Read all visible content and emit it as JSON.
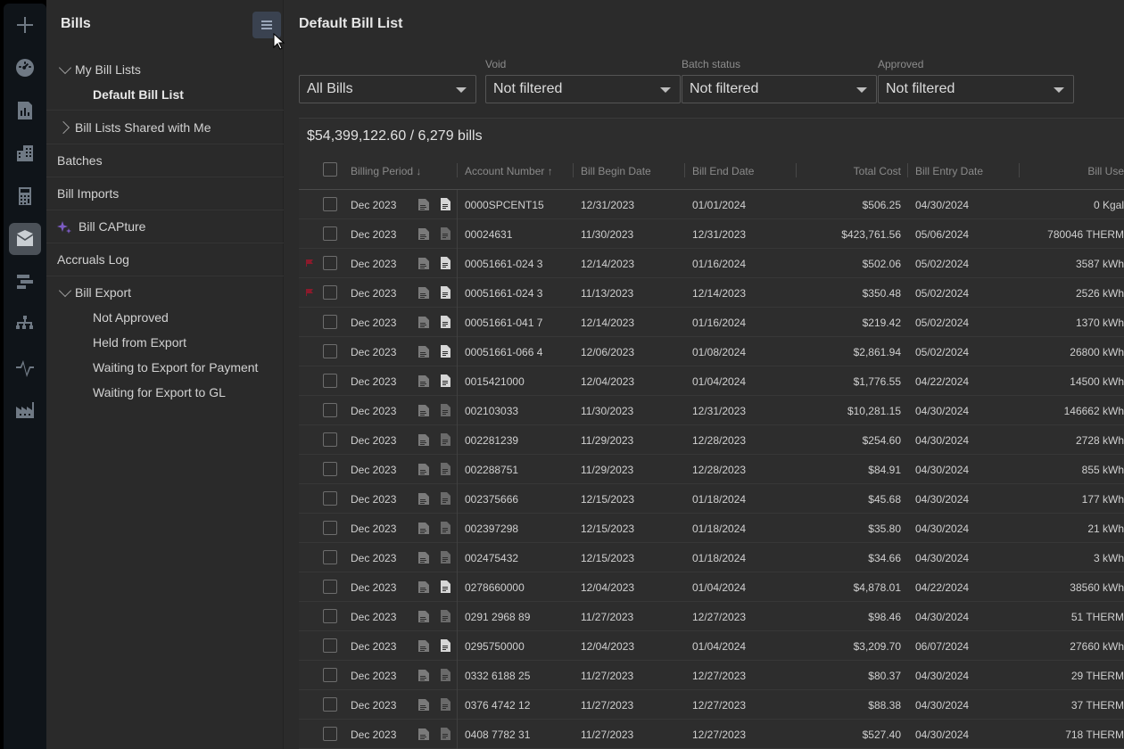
{
  "subnav": {
    "title": "Bills",
    "items": [
      {
        "label": "My Bill Lists"
      },
      {
        "label": "Default Bill List"
      },
      {
        "label": "Bill Lists Shared with Me"
      },
      {
        "label": "Batches"
      },
      {
        "label": "Bill Imports"
      },
      {
        "label": "Bill CAPture"
      },
      {
        "label": "Accruals Log"
      },
      {
        "label": "Bill Export"
      },
      {
        "label": "Not Approved"
      },
      {
        "label": "Held from Export"
      },
      {
        "label": "Waiting to Export for Payment"
      },
      {
        "label": "Waiting for Export to GL"
      }
    ]
  },
  "main": {
    "title": "Default Bill List",
    "filters": {
      "list_value": "All Bills",
      "void_label": "Void",
      "void_value": "Not filtered",
      "batch_label": "Batch status",
      "batch_value": "Not filtered",
      "approved_label": "Approved",
      "approved_value": "Not filtered"
    },
    "summary": "$54,399,122.60 / 6,279 bills",
    "columns": {
      "billing_period": "Billing Period",
      "account_number": "Account Number",
      "begin": "Bill Begin Date",
      "end": "Bill End Date",
      "total": "Total Cost",
      "entry": "Bill Entry Date",
      "use": "Bill Use"
    },
    "rows": [
      {
        "period": "Dec 2023",
        "account": "0000SPCENT15",
        "begin": "12/31/2023",
        "end": "01/01/2024",
        "total": "$506.25",
        "entry": "04/30/2024",
        "use": "0 Kgal"
      },
      {
        "period": "Dec 2023",
        "account": "00024631",
        "begin": "11/30/2023",
        "end": "12/31/2023",
        "total": "$423,761.56",
        "entry": "05/06/2024",
        "use": "780046 THERM"
      },
      {
        "period": "Dec 2023",
        "account": "00051661-024 3",
        "begin": "12/14/2023",
        "end": "01/16/2024",
        "total": "$502.06",
        "entry": "05/02/2024",
        "use": "3587 kWh"
      },
      {
        "period": "Dec 2023",
        "account": "00051661-024 3",
        "begin": "11/13/2023",
        "end": "12/14/2023",
        "total": "$350.48",
        "entry": "05/02/2024",
        "use": "2526 kWh"
      },
      {
        "period": "Dec 2023",
        "account": "00051661-041 7",
        "begin": "12/14/2023",
        "end": "01/16/2024",
        "total": "$219.42",
        "entry": "05/02/2024",
        "use": "1370 kWh"
      },
      {
        "period": "Dec 2023",
        "account": "00051661-066 4",
        "begin": "12/06/2023",
        "end": "01/08/2024",
        "total": "$2,861.94",
        "entry": "05/02/2024",
        "use": "26800 kWh"
      },
      {
        "period": "Dec 2023",
        "account": "0015421000",
        "begin": "12/04/2023",
        "end": "01/04/2024",
        "total": "$1,776.55",
        "entry": "04/22/2024",
        "use": "14500 kWh"
      },
      {
        "period": "Dec 2023",
        "account": "002103033",
        "begin": "11/30/2023",
        "end": "12/31/2023",
        "total": "$10,281.15",
        "entry": "04/30/2024",
        "use": "146662 kWh"
      },
      {
        "period": "Dec 2023",
        "account": "002281239",
        "begin": "11/29/2023",
        "end": "12/28/2023",
        "total": "$254.60",
        "entry": "04/30/2024",
        "use": "2728 kWh"
      },
      {
        "period": "Dec 2023",
        "account": "002288751",
        "begin": "11/29/2023",
        "end": "12/28/2023",
        "total": "$84.91",
        "entry": "04/30/2024",
        "use": "855 kWh"
      },
      {
        "period": "Dec 2023",
        "account": "002375666",
        "begin": "12/15/2023",
        "end": "01/18/2024",
        "total": "$45.68",
        "entry": "04/30/2024",
        "use": "177 kWh"
      },
      {
        "period": "Dec 2023",
        "account": "002397298",
        "begin": "12/15/2023",
        "end": "01/18/2024",
        "total": "$35.80",
        "entry": "04/30/2024",
        "use": "21 kWh"
      },
      {
        "period": "Dec 2023",
        "account": "002475432",
        "begin": "12/15/2023",
        "end": "01/18/2024",
        "total": "$34.66",
        "entry": "04/30/2024",
        "use": "3 kWh"
      },
      {
        "period": "Dec 2023",
        "account": "0278660000",
        "begin": "12/04/2023",
        "end": "01/04/2024",
        "total": "$4,878.01",
        "entry": "04/22/2024",
        "use": "38560 kWh"
      },
      {
        "period": "Dec 2023",
        "account": "0291 2968 89",
        "begin": "11/27/2023",
        "end": "12/27/2023",
        "total": "$98.46",
        "entry": "04/30/2024",
        "use": "51 THERM"
      },
      {
        "period": "Dec 2023",
        "account": "0295750000",
        "begin": "12/04/2023",
        "end": "01/04/2024",
        "total": "$3,209.70",
        "entry": "06/07/2024",
        "use": "27660 kWh"
      },
      {
        "period": "Dec 2023",
        "account": "0332 6188 25",
        "begin": "11/27/2023",
        "end": "12/27/2023",
        "total": "$80.37",
        "entry": "04/30/2024",
        "use": "29 THERM"
      },
      {
        "period": "Dec 2023",
        "account": "0376 4742 12",
        "begin": "11/27/2023",
        "end": "12/27/2023",
        "total": "$88.38",
        "entry": "04/30/2024",
        "use": "37 THERM"
      },
      {
        "period": "Dec 2023",
        "account": "0408 7782 31",
        "begin": "11/27/2023",
        "end": "12/27/2023",
        "total": "$527.40",
        "entry": "04/30/2024",
        "use": "718 THERM"
      }
    ],
    "flagged_rows": [
      2,
      3
    ],
    "pdf_active_rows": [
      0,
      2,
      3,
      4,
      5,
      6,
      13,
      15
    ]
  },
  "colors": {
    "flag": "#8b1a2b",
    "rail_bg": "#0f1419",
    "active_rail": "#4b5158"
  }
}
